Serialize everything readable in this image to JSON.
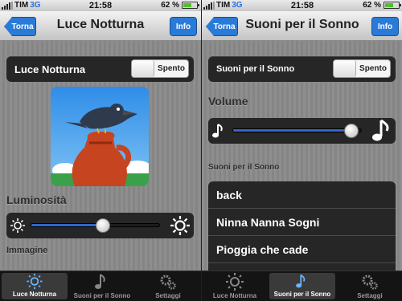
{
  "status": {
    "carrier": "TIM",
    "network": "3G",
    "time": "21:58",
    "battery": "62 %",
    "battery_level": 0.62
  },
  "colors": {
    "accent": "#2a7bd8",
    "slider_fill": "#3466c8",
    "row_bg": "#262626"
  },
  "left": {
    "nav": {
      "back": "Torna",
      "title": "Luce Notturna",
      "info": "Info"
    },
    "toggle_row": {
      "label": "Luce Notturna",
      "state": "Spento"
    },
    "image": {
      "icon": "crow-on-jug-illustration"
    },
    "brightness": {
      "label": "Luminosità",
      "value": 0.56,
      "icon_min": "sun-small-icon",
      "icon_max": "sun-large-icon"
    },
    "image_section": {
      "label": "Immagine"
    }
  },
  "right": {
    "nav": {
      "back": "Torna",
      "title": "Suoni per il Sonno",
      "info": "Info"
    },
    "toggle_row": {
      "label": "Suoni per il Sonno",
      "state": "Spento"
    },
    "volume": {
      "label": "Volume",
      "value": 0.92,
      "icon_min": "music-note-small-icon",
      "icon_max": "music-note-large-icon"
    },
    "sounds_section": {
      "label": "Suoni per il Sonno"
    },
    "sounds": [
      "back",
      "Ninna Nanna Sogni",
      "Pioggia che cade"
    ]
  },
  "tabs": [
    {
      "label": "Luce Notturna",
      "icon": "sun-icon"
    },
    {
      "label": "Suoni per il Sonno",
      "icon": "music-note-icon"
    },
    {
      "label": "Settaggi",
      "icon": "gears-icon"
    }
  ],
  "selected_tab": {
    "left": 0,
    "right": 1
  }
}
